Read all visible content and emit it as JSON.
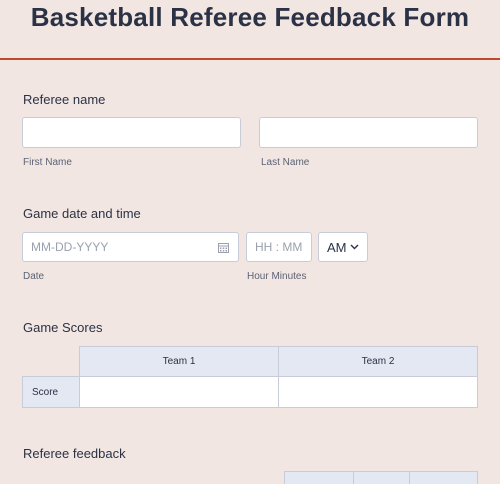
{
  "form": {
    "title": "Basketball Referee Feedback Form",
    "accent_color": "#c0492b"
  },
  "referee_name": {
    "label": "Referee name",
    "first_name_value": "",
    "last_name_value": "",
    "first_name_sublabel": "First Name",
    "last_name_sublabel": "Last Name"
  },
  "game_datetime": {
    "label": "Game date and time",
    "date_placeholder": "MM-DD-YYYY",
    "date_icon": "calendar-icon",
    "time_placeholder": "HH : MM",
    "ampm_selected": "AM",
    "date_sublabel": "Date",
    "time_sublabel": "Hour Minutes"
  },
  "game_scores": {
    "label": "Game Scores",
    "columns": [
      "Team 1",
      "Team 2"
    ],
    "rows": [
      "Score"
    ]
  },
  "referee_feedback": {
    "label": "Referee feedback"
  }
}
